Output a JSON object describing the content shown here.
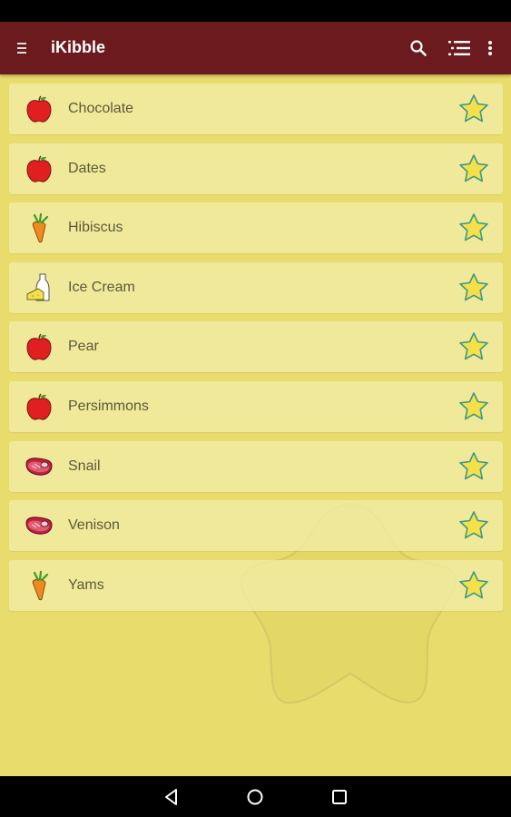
{
  "app": {
    "title": "iKibble",
    "colors": {
      "app_bar": "#6b1a1d",
      "background": "#e8dc6c",
      "row": "#f2ecaa",
      "star": "#f5e04a",
      "star_outline": "#3a9a8a"
    }
  },
  "toolbar": {
    "menu_icon": "menu-icon",
    "search_icon": "search-icon",
    "list_icon": "list-icon",
    "more_icon": "more-vert-icon"
  },
  "foods": [
    {
      "name": "Chocolate",
      "icon": "apple-icon"
    },
    {
      "name": "Dates",
      "icon": "apple-icon"
    },
    {
      "name": "Hibiscus",
      "icon": "carrot-icon"
    },
    {
      "name": "Ice Cream",
      "icon": "dairy-icon"
    },
    {
      "name": "Pear",
      "icon": "apple-icon"
    },
    {
      "name": "Persimmons",
      "icon": "apple-icon"
    },
    {
      "name": "Snail",
      "icon": "meat-icon"
    },
    {
      "name": "Venison",
      "icon": "meat-icon"
    },
    {
      "name": "Yams",
      "icon": "carrot-icon"
    }
  ],
  "navigation": {
    "back_icon": "back-icon",
    "home_icon": "home-icon",
    "recents_icon": "recents-icon"
  }
}
